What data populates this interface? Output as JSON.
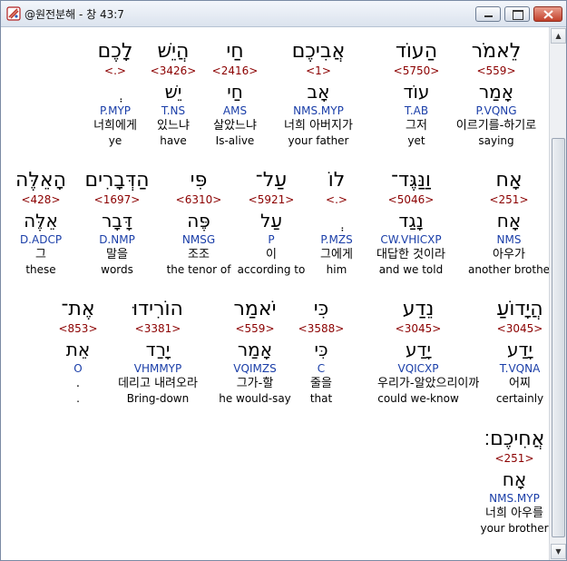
{
  "window": {
    "title": "@원전분해 - 창 43:7",
    "min_glyph": "▬",
    "max_glyph": "□",
    "close_glyph": "✕"
  },
  "scroll": {
    "up": "▲",
    "down": "▼"
  },
  "rows": [
    {
      "words": [
        {
          "heb": "לֵאמֹר",
          "num": "<559>",
          "lex": "אָמַר",
          "pars": "P.VQNG",
          "kor": "이르기를-하기로",
          "eng": "saying"
        },
        {
          "heb": "הַעוֹד",
          "num": "<5750>",
          "lex": "עוֹד",
          "pars": "T.AB",
          "kor": "그저",
          "eng": "yet"
        },
        {
          "heb": "אֲבִיכֶם",
          "num": "<1>",
          "lex": "אָב",
          "pars": "NMS.MYP",
          "kor": "너희 아버지가",
          "eng": "your father"
        },
        {
          "heb": "חַי",
          "num": "<2416>",
          "lex": "חַי",
          "pars": "AMS",
          "kor": "살았느냐",
          "eng": "Is-alive"
        },
        {
          "heb": "הֲיֵשׁ",
          "num": "<3426>",
          "lex": "יֵשׁ",
          "pars": "T.NS",
          "kor": "있느냐",
          "eng": "have"
        },
        {
          "heb": "לָכֶם",
          "num": "<.>",
          "lex": "ְ",
          "pars": "P.MYP",
          "kor": "너희에게",
          "eng": "ye"
        }
      ]
    },
    {
      "words": [
        {
          "heb": "אָח",
          "num": "<251>",
          "lex": "אָח",
          "pars": "NMS",
          "kor": "아우가",
          "eng": "another brother"
        },
        {
          "heb": "וַנַּגֶּד־",
          "num": "<5046>",
          "lex": "נָגַד",
          "pars": "CW.VHICXP",
          "kor": "대답한 것이라",
          "eng": "and we told"
        },
        {
          "heb": "לוֹ",
          "num": "<.>",
          "lex": "ְ",
          "pars": "P.MZS",
          "kor": "그에게",
          "eng": "him"
        },
        {
          "heb": "עַל־",
          "num": "<5921>",
          "lex": "עַל",
          "pars": "P",
          "kor": "이",
          "eng": "according to"
        },
        {
          "heb": "פִּי",
          "num": "<6310>",
          "lex": "פֶּה",
          "pars": "NMSG",
          "kor": "조조",
          "eng": "the tenor of"
        },
        {
          "heb": "הַדְּבָרִים",
          "num": "<1697>",
          "lex": "דָּבָר",
          "pars": "D.NMP",
          "kor": "말을",
          "eng": "words"
        },
        {
          "heb": "הָאֵלֶּה",
          "num": "<428>",
          "lex": "אֵלֶּה",
          "pars": "D.ADCP",
          "kor": "그",
          "eng": "these"
        }
      ]
    },
    {
      "words": [
        {
          "heb": "הֲיָדוֹעַ",
          "num": "<3045>",
          "lex": "יָדַע",
          "pars": "T.VQNA",
          "kor": "어찌",
          "eng": "certainly"
        },
        {
          "heb": "נֵדַע",
          "num": "<3045>",
          "lex": "יָדַע",
          "pars": "VQICXP",
          "kor": "우리가-알았으리이까",
          "eng": "could we-know"
        },
        {
          "heb": "כִּי",
          "num": "<3588>",
          "lex": "כִּי",
          "pars": "C",
          "kor": "줄을",
          "eng": "that"
        },
        {
          "heb": "יֹאמַר",
          "num": "<559>",
          "lex": "אָמַר",
          "pars": "VQIMZS",
          "kor": "그가-할",
          "eng": "he would-say"
        },
        {
          "heb": "הוֹרִידוּ",
          "num": "<3381>",
          "lex": "יָרַד",
          "pars": "VHMMYP",
          "kor": "데리고 내려오라",
          "eng": "Bring-down"
        },
        {
          "heb": "אֶת־",
          "num": "<853>",
          "lex": "אֵת",
          "pars": "O",
          "kor": ".",
          "eng": "."
        }
      ]
    },
    {
      "words": [
        {
          "heb": "אֲחִיכֶם׃",
          "num": "<251>",
          "lex": "אָח",
          "pars": "NMS.MYP",
          "kor": "너희 아우를",
          "eng": "your brother"
        }
      ]
    }
  ]
}
